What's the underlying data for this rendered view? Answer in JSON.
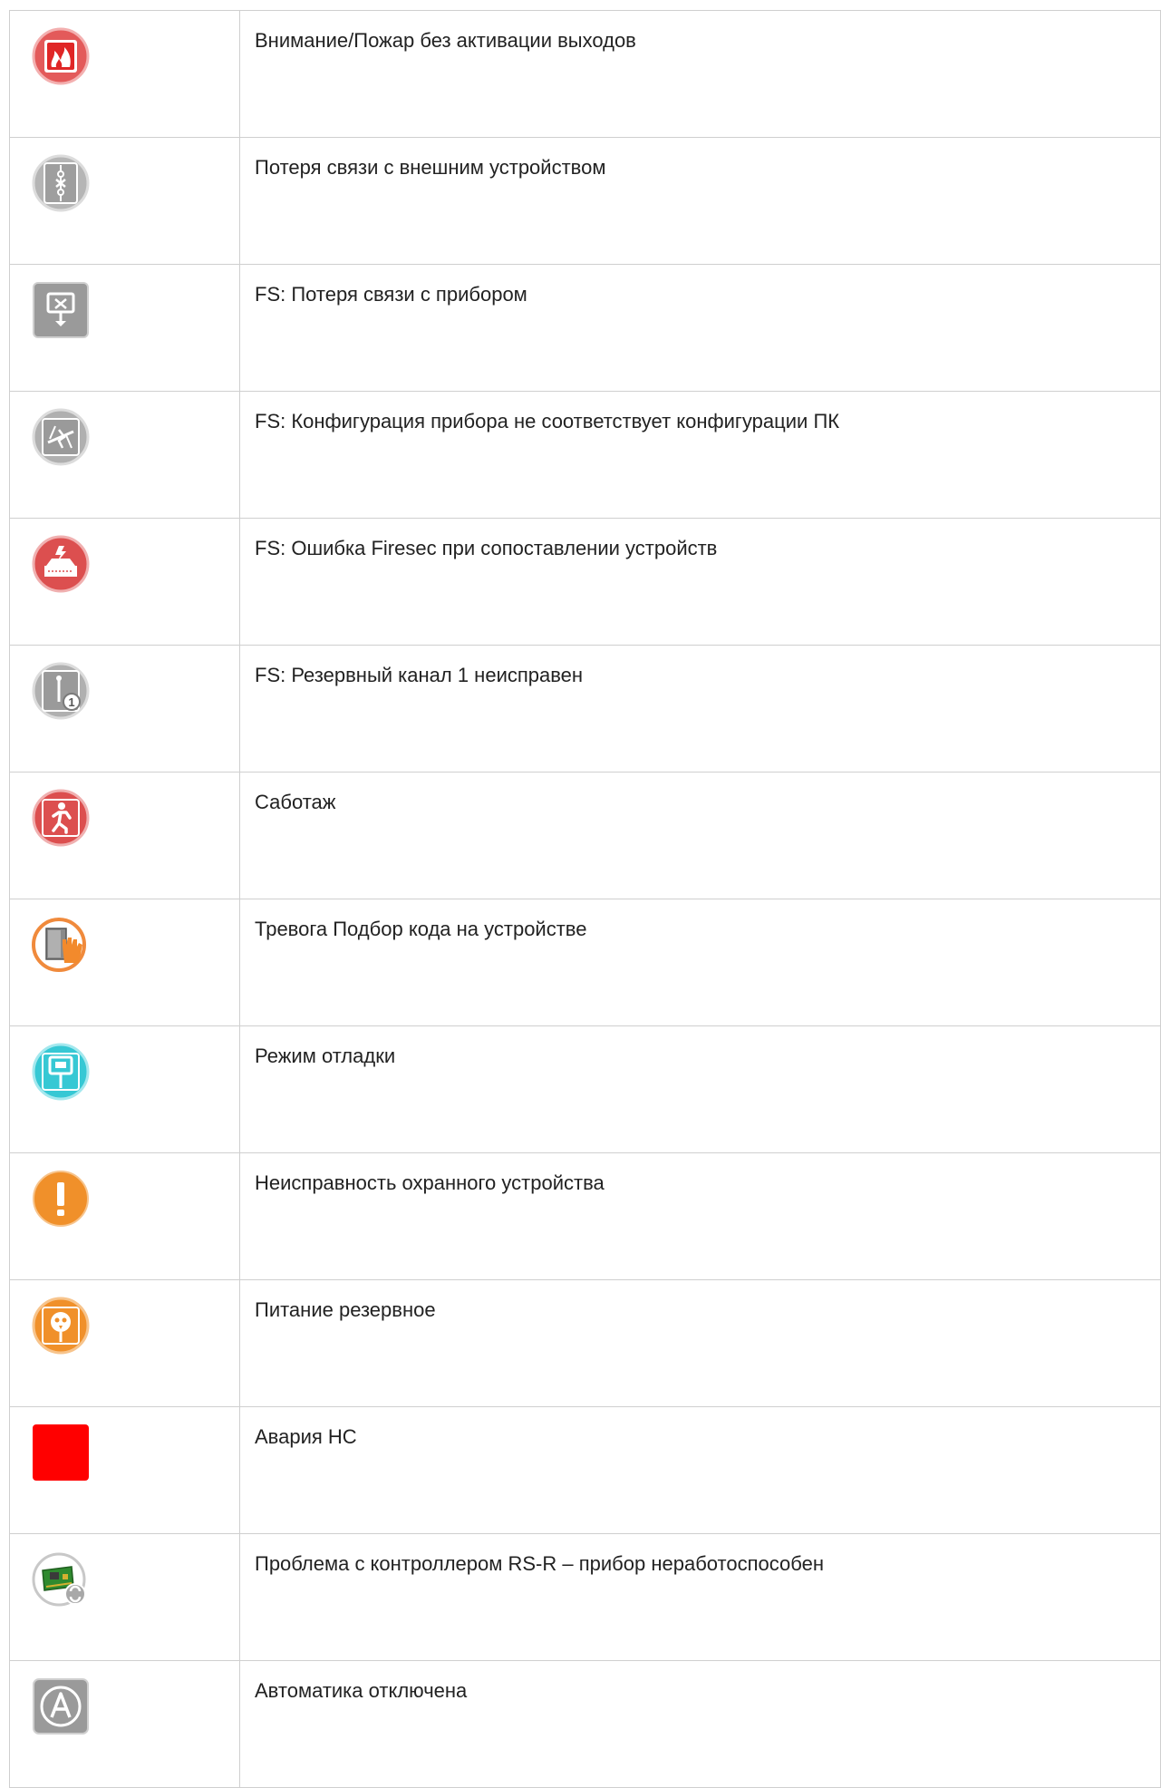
{
  "rows": [
    {
      "icon": "fire-alarm-icon",
      "label": "Внимание/Пожар без активации выходов"
    },
    {
      "icon": "link-lost-icon",
      "label": "Потеря связи с внешним устройством"
    },
    {
      "icon": "device-connection-lost-icon",
      "label": "FS: Потеря связи с прибором"
    },
    {
      "icon": "config-mismatch-icon",
      "label": "FS: Конфигурация прибора не соответствует конфигурации ПК"
    },
    {
      "icon": "firesec-error-icon",
      "label": "FS: Ошибка Firesec при сопоставлении устройств"
    },
    {
      "icon": "backup-channel-fault-icon",
      "label": "FS: Резервный канал 1 неисправен"
    },
    {
      "icon": "sabotage-icon",
      "label": "Саботаж"
    },
    {
      "icon": "code-guessing-alarm-icon",
      "label": "Тревога Подбор кода на устройстве"
    },
    {
      "icon": "debug-mode-icon",
      "label": "Режим отладки"
    },
    {
      "icon": "security-device-fault-icon",
      "label": "Неисправность охранного устройства"
    },
    {
      "icon": "backup-power-icon",
      "label": "Питание резервное"
    },
    {
      "icon": "pump-station-failure-icon",
      "label": "Авария НС"
    },
    {
      "icon": "rs-r-controller-problem-icon",
      "label": "Проблема с контроллером RS-R – прибор неработоспособен"
    },
    {
      "icon": "automation-disabled-icon",
      "label": "Автоматика отключена"
    }
  ],
  "colors": {
    "red": "#e05252",
    "gray": "#a0a0a0",
    "orange": "#f0932b",
    "cyan": "#3ccfd8",
    "solid_red": "#ff0000"
  }
}
